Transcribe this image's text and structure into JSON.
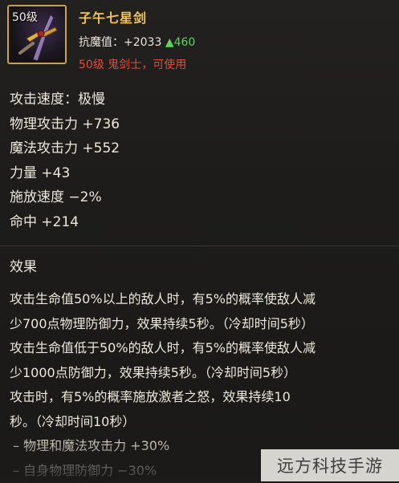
{
  "item": {
    "level_badge": "50级",
    "name": "子午七星剑",
    "resist_label": "抗魔值：+2033",
    "resist_increase": "▲460",
    "requirement": "50级 鬼剑士，可使用",
    "icon": "sword-icon"
  },
  "stats": [
    "攻击速度：极慢",
    "物理攻击力 +736",
    "魔法攻击力 +552",
    "力量 +43",
    "施放速度 −2%",
    "命中 +214"
  ],
  "effect": {
    "heading": "效果",
    "lines": [
      "攻击生命值50%以上的敌人时，有5%的概率使敌人减",
      "少700点物理防御力，效果持续5秒。（冷却时间5秒）",
      "攻击生命值低于50%的敌人时，有5%的概率使敌人减",
      "少1000点防御力，效果持续5秒。（冷却时间5秒）",
      "攻击时，有5%的概率施放激者之怒，效果持续10",
      "秒。（冷却时间10秒）",
      "– 物理和魔法攻击力 +30%",
      "– 自身物理防御力 −30%"
    ]
  },
  "watermark": "远方科技手游",
  "colors": {
    "title_gold": "#f1c453",
    "increase_green": "#5fd35a",
    "requirement_red": "#e64a3d",
    "text": "#ece7dc",
    "background": "#1c1b19"
  }
}
